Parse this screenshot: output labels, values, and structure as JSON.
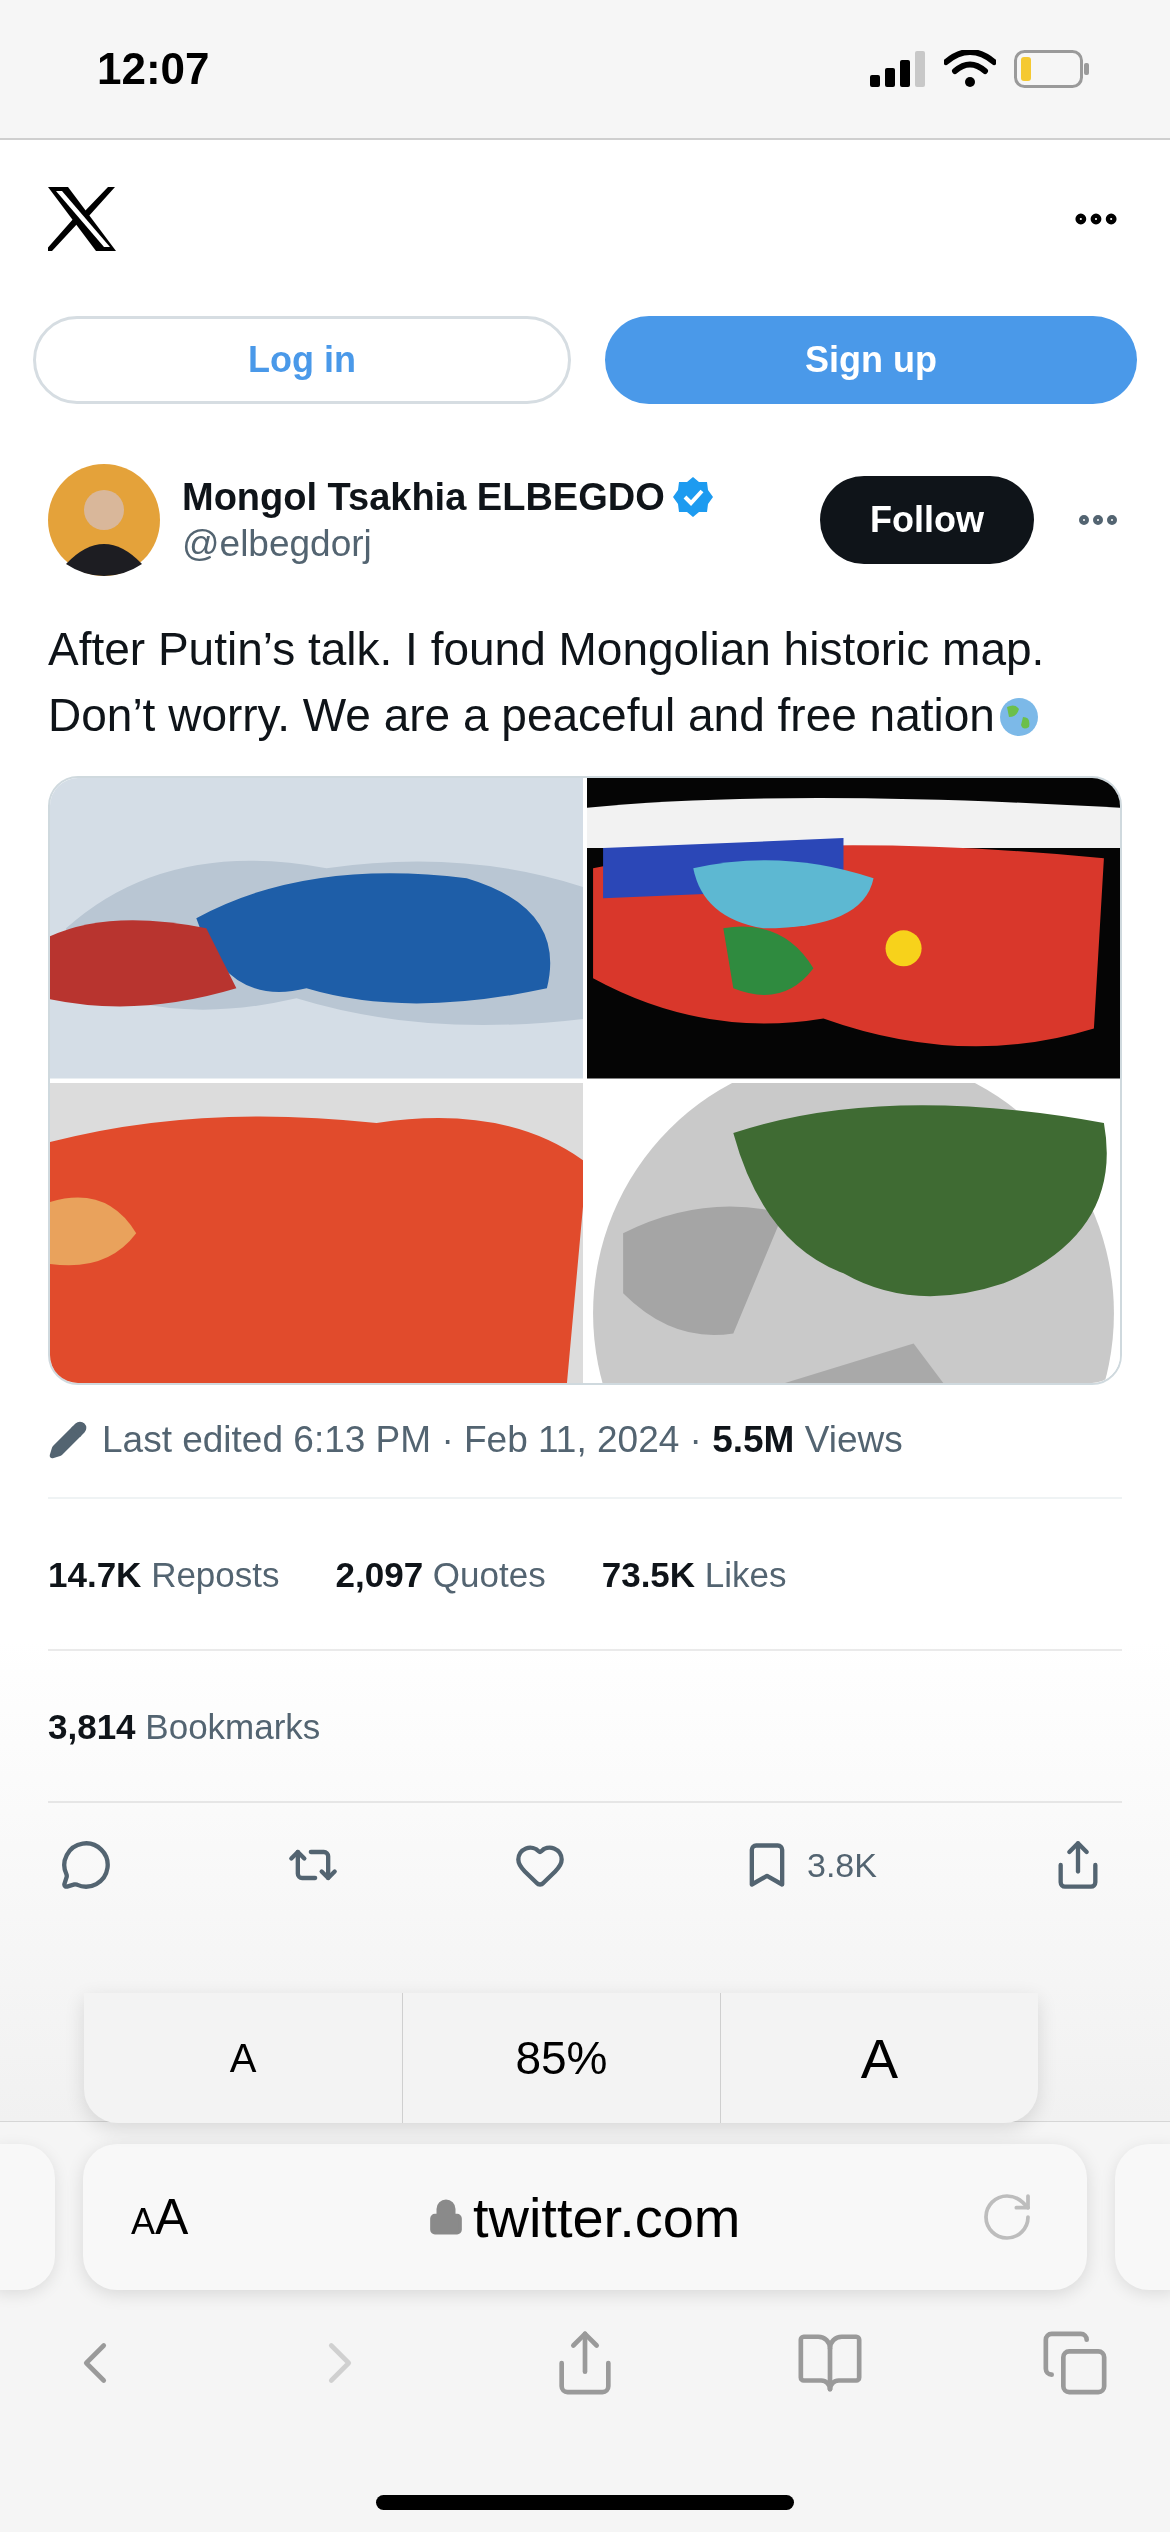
{
  "status_bar": {
    "time": "12:07"
  },
  "auth_buttons": [
    {
      "label": "Log in",
      "kind": "outline"
    },
    {
      "label": "Sign up",
      "kind": "filled"
    }
  ],
  "author": {
    "name": "Mongol Tsakhia ELBEGDO",
    "verified": true,
    "handle": "@elbegdorj",
    "follow_label": "Follow"
  },
  "tweet_text": "After Putin’s talk. I found Mongolian historic map. Don’t worry. We are a peaceful and free nation",
  "media": [
    {
      "kind": "picture"
    },
    {
      "kind": "picture"
    },
    {
      "kind": "picture"
    },
    {
      "kind": "picture"
    }
  ],
  "meta": "Last edited 6:13 PM · Feb 11, 2024 · **5.5M** Views",
  "stats": [
    "**14.7K** Reposts",
    "**2,097** Quotes",
    "**73.5K** Likes"
  ],
  "bookmarks": "**3,814** Bookmarks",
  "actions": [
    {
      "kind": "reply"
    },
    {
      "kind": "repost"
    },
    {
      "kind": "like"
    },
    {
      "kind": "bookmark",
      "count": "3.8K"
    },
    {
      "kind": "share"
    }
  ],
  "text_zoom": {
    "smaller": "A",
    "level": "85%",
    "larger": "A"
  },
  "address_bar": {
    "format_button": "AA",
    "url": "twitter.com"
  },
  "toolbar": [
    {
      "kind": "back",
      "disabled": false
    },
    {
      "kind": "forward",
      "disabled": true
    },
    {
      "kind": "share",
      "disabled": false
    },
    {
      "kind": "bookmarks",
      "disabled": false
    },
    {
      "kind": "tabs",
      "disabled": false
    }
  ]
}
